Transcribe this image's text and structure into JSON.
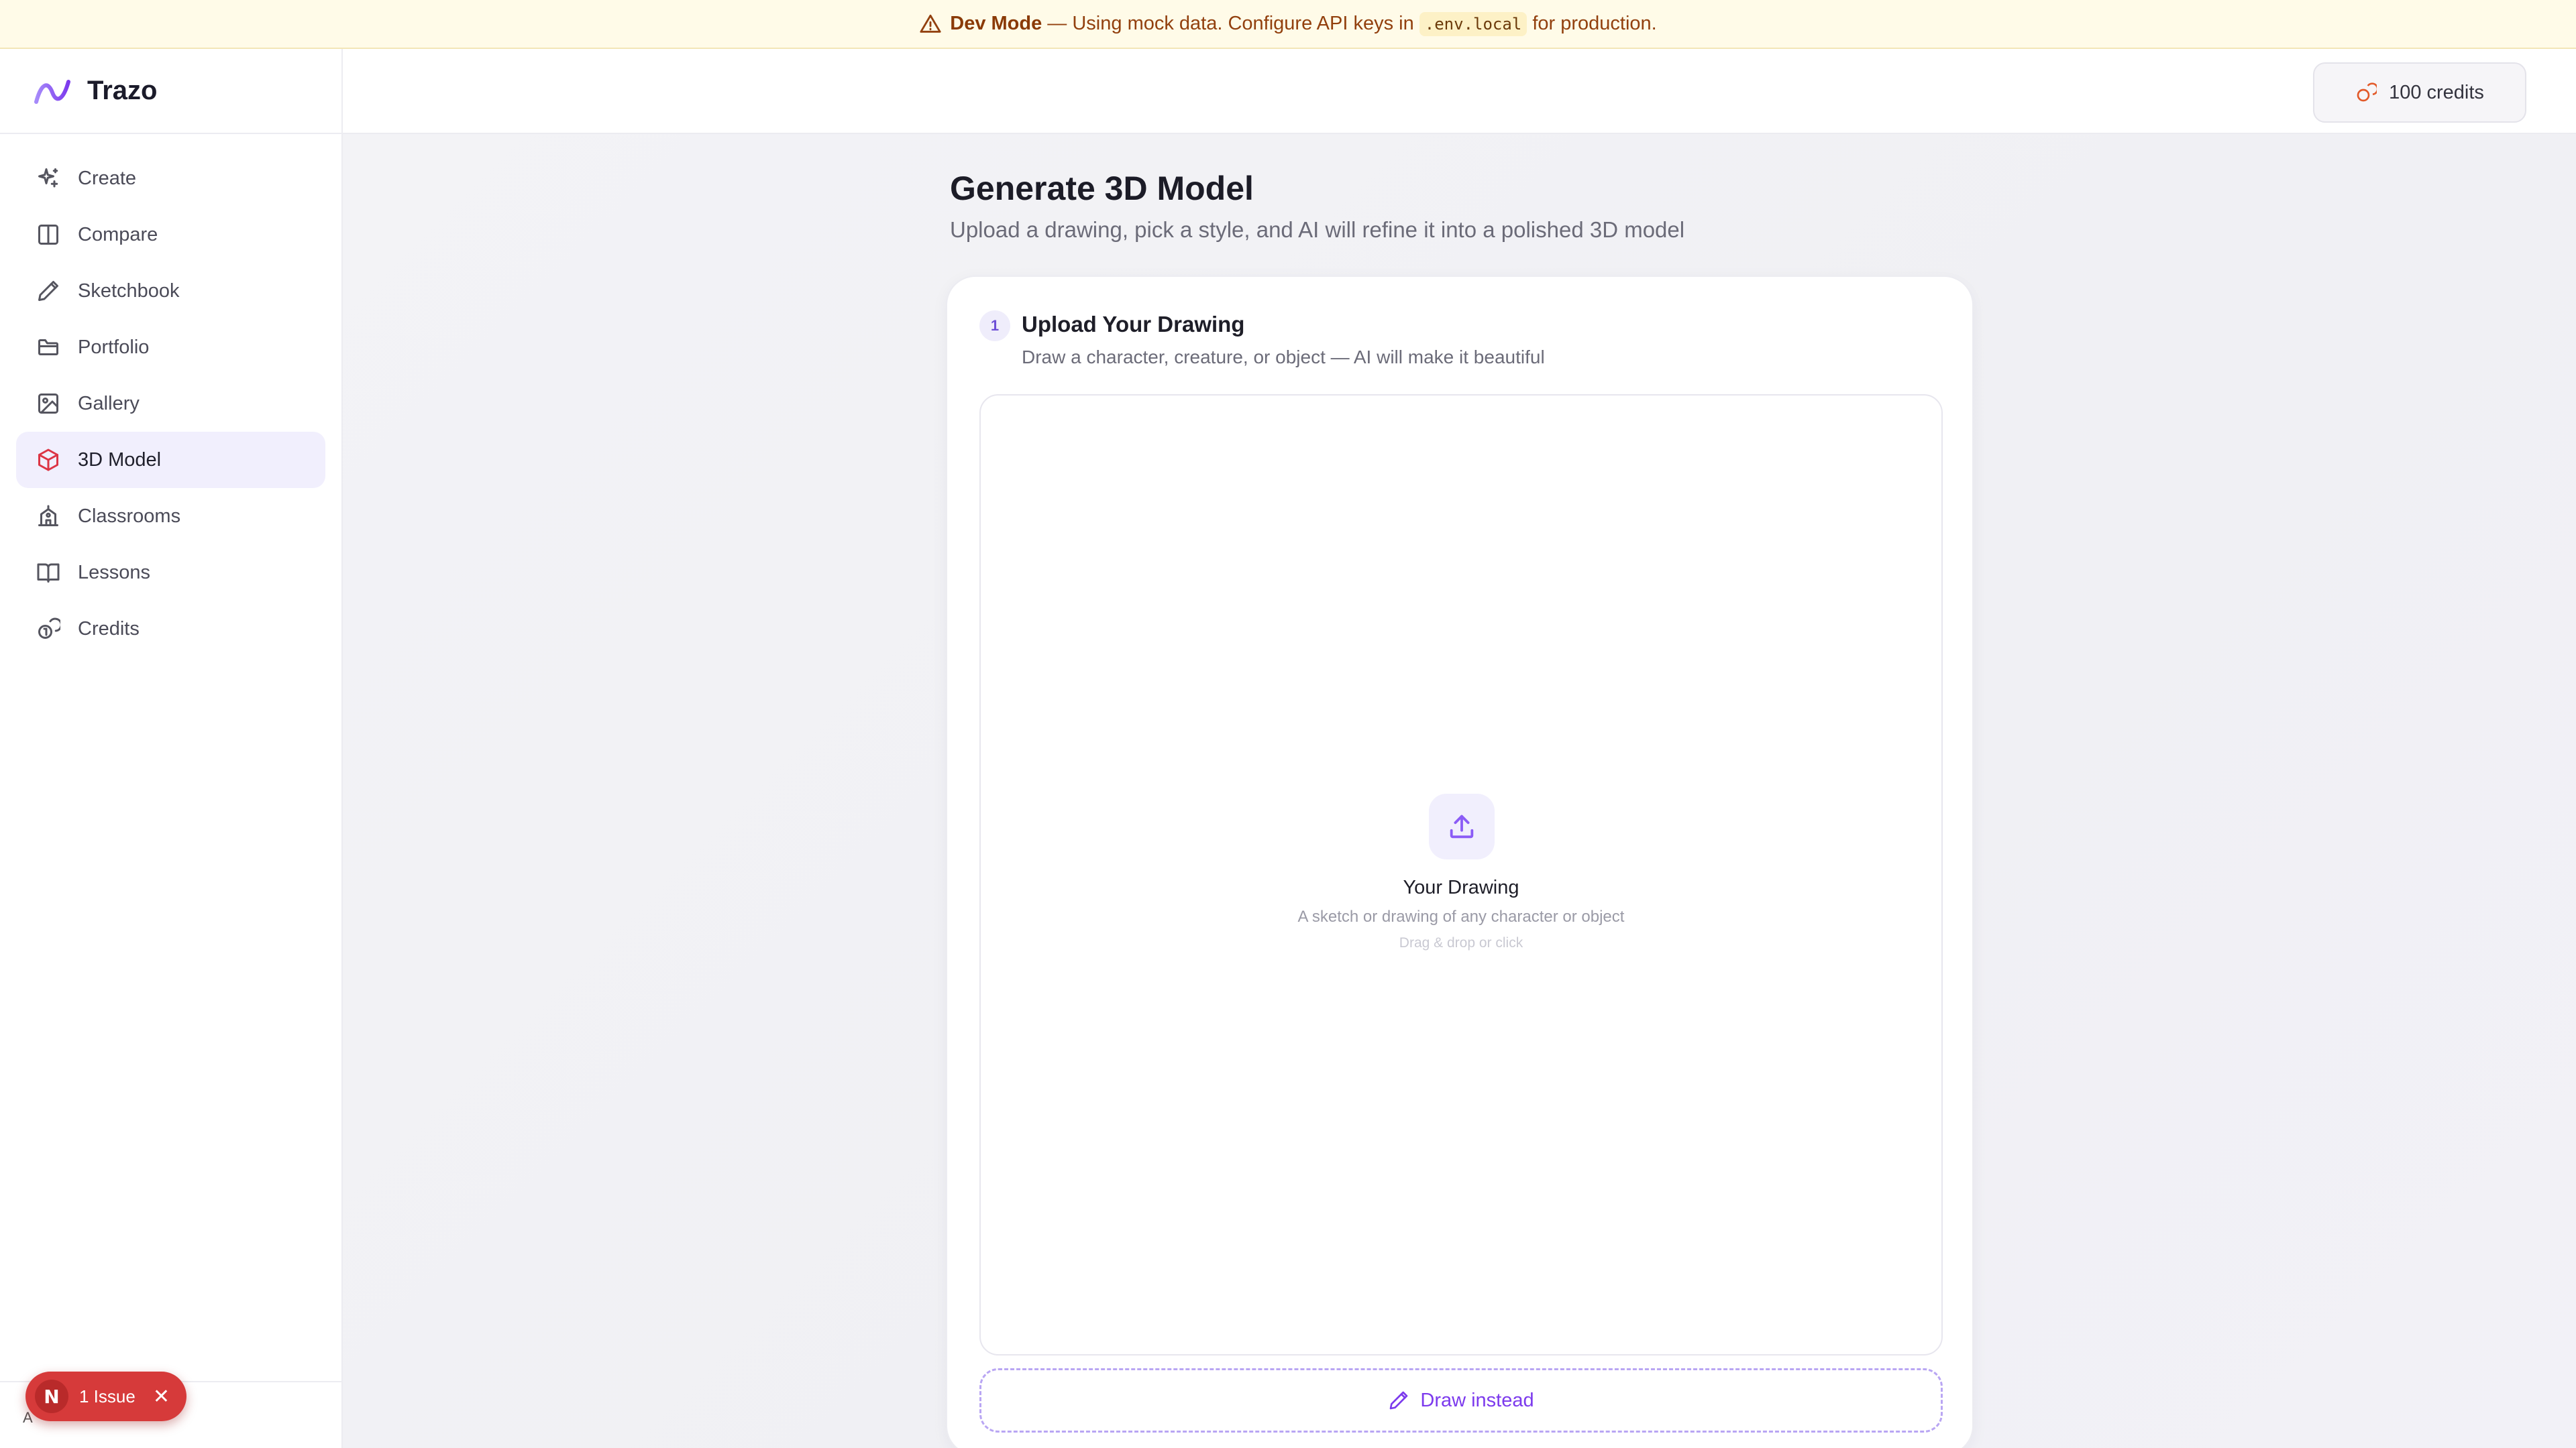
{
  "banner": {
    "title": "Dev Mode",
    "text_before_code": " — Using mock data. Configure API keys in ",
    "code": ".env.local",
    "text_after_code": " for production."
  },
  "brand": {
    "name": "Trazo"
  },
  "sidebar": {
    "items": [
      {
        "label": "Create",
        "icon": "sparkles-icon",
        "active": false
      },
      {
        "label": "Compare",
        "icon": "columns-icon",
        "active": false
      },
      {
        "label": "Sketchbook",
        "icon": "pencil-icon",
        "active": false
      },
      {
        "label": "Portfolio",
        "icon": "folder-icon",
        "active": false
      },
      {
        "label": "Gallery",
        "icon": "image-icon",
        "active": false
      },
      {
        "label": "3D Model",
        "icon": "cube-icon",
        "active": true
      },
      {
        "label": "Classrooms",
        "icon": "school-icon",
        "active": false
      },
      {
        "label": "Lessons",
        "icon": "book-icon",
        "active": false
      },
      {
        "label": "Credits",
        "icon": "coins-icon",
        "active": false
      }
    ]
  },
  "topbar": {
    "credits_label": "100 credits"
  },
  "page": {
    "title": "Generate 3D Model",
    "subtitle": "Upload a drawing, pick a style, and AI will refine it into a polished 3D model"
  },
  "step1": {
    "number": "1",
    "title": "Upload Your Drawing",
    "subtitle": "Draw a character, creature, or object — AI will make it beautiful",
    "dropzone_title": "Your Drawing",
    "dropzone_sub": "A sketch or drawing of any character or object",
    "dropzone_hint": "Drag & drop or click",
    "draw_button": "Draw instead"
  },
  "issue_badge": {
    "logo": "N",
    "label": "1 Issue",
    "close": "✕"
  },
  "sidebar_foot": {
    "text": "A"
  },
  "colors": {
    "accent": "#7c3aed",
    "active_bg": "#f1effd",
    "banner_bg": "#fffbe8",
    "issue_red": "#d63a3a"
  }
}
